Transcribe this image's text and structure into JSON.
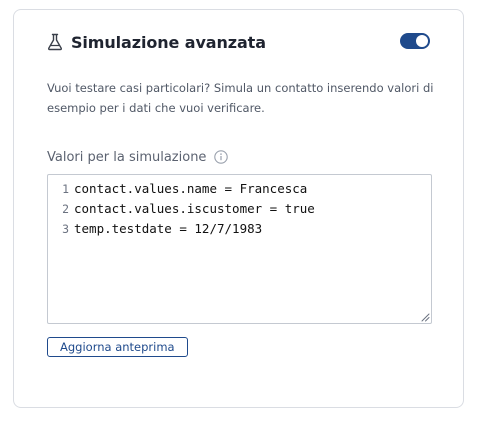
{
  "panel": {
    "title": "Simulazione avanzata",
    "title_icon": "flask-icon",
    "toggle": {
      "on": true,
      "accent": "#1f4a8c"
    },
    "description": "Vuoi testare casi particolari? Simula un contatto inserendo valori di esempio per i dati che vuoi verificare.",
    "field_label": "Valori per la simulazione",
    "field_icon": "info-icon",
    "editor_lines": [
      {
        "number": "1",
        "text": "contact.values.name = Francesca"
      },
      {
        "number": "2",
        "text": "contact.values.iscustomer = true"
      },
      {
        "number": "3",
        "text": "temp.testdate = 12/7/1983"
      }
    ],
    "preview_button": "Aggiorna anteprima"
  }
}
